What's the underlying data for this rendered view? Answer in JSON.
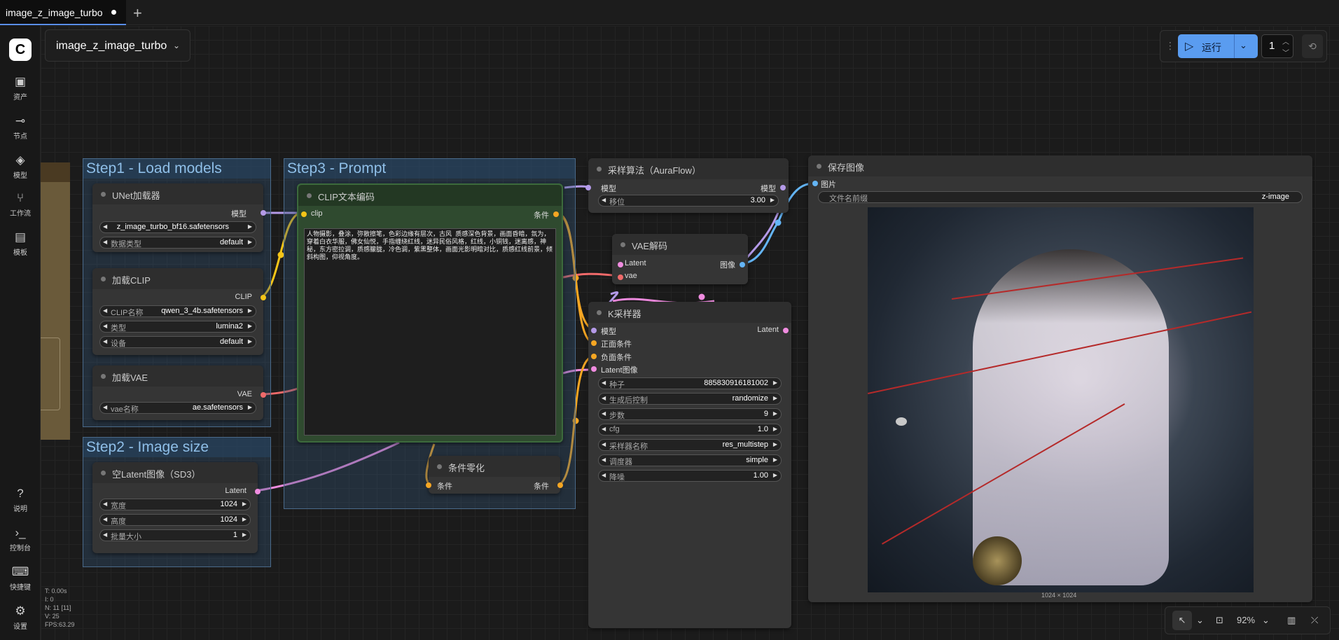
{
  "tabs": [
    {
      "label": "image_z_image_turbo"
    }
  ],
  "sidebar": {
    "items": [
      {
        "label": "资产",
        "icon": "image-icon"
      },
      {
        "label": "节点",
        "icon": "node-icon"
      },
      {
        "label": "模型",
        "icon": "model-icon"
      },
      {
        "label": "工作流",
        "icon": "workflow-icon"
      },
      {
        "label": "模板",
        "icon": "template-icon"
      }
    ],
    "bottom_items": [
      {
        "label": "说明",
        "icon": "help-icon"
      },
      {
        "label": "控制台",
        "icon": "console-icon"
      },
      {
        "label": "快捷键",
        "icon": "keyboard-icon"
      },
      {
        "label": "设置",
        "icon": "settings-icon"
      }
    ]
  },
  "workflow_name": "image_z_image_turbo",
  "run": {
    "label": "运行",
    "count": "1"
  },
  "groups": {
    "step1": "Step1 - Load models",
    "step2": "Step2 - Image size",
    "step3": "Step3 - Prompt"
  },
  "nodes": {
    "unet": {
      "title": "UNet加载器",
      "out": "模型",
      "w_unet_value": "z_image_turbo_bf16.safetensors",
      "w_dtype_label": "数据类型",
      "w_dtype_value": "default"
    },
    "clip": {
      "title": "加载CLIP",
      "out": "CLIP",
      "w_name_label": "CLIP名称",
      "w_name_value": "qwen_3_4b.safetensors",
      "w_type_label": "类型",
      "w_type_value": "lumina2",
      "w_device_label": "设备",
      "w_device_value": "default"
    },
    "vae": {
      "title": "加载VAE",
      "out": "VAE",
      "w_label": "vae名称",
      "w_value": "ae.safetensors"
    },
    "latent": {
      "title": "空Latent图像（SD3）",
      "out": "Latent",
      "w_width_label": "宽度",
      "w_width_value": "1024",
      "w_height_label": "高度",
      "w_height_value": "1024",
      "w_batch_label": "批量大小",
      "w_batch_value": "1"
    },
    "clipenc": {
      "title": "CLIP文本编码",
      "in": "clip",
      "out": "条件",
      "prompt": "人物摄影，叠涂，弥散擦笔，色彩边缘有层次，古风 质感深色背景，画面昏暗，氛为，穿着白衣华服，佛女仙悦，手指缠绕红线，迷异民俗风格，红线，小铜钱，迷离感，神秘，东方密拉调，质感朦胧，冷色调，紫黑整体，画面光影明暗对比，质感红线前景，倾斜构图，仰视角度。"
    },
    "zero": {
      "title": "条件零化",
      "in": "条件",
      "out": "条件"
    },
    "aura": {
      "title": "采样算法（AuraFlow）",
      "in": "模型",
      "out": "模型",
      "w_label": "移位",
      "w_value": "3.00"
    },
    "vaedec": {
      "title": "VAE解码",
      "in1": "Latent",
      "in2": "vae",
      "out": "图像"
    },
    "ksampler": {
      "title": "K采样器",
      "inputs": [
        "模型",
        "正面条件",
        "负面条件",
        "Latent图像"
      ],
      "out": "Latent",
      "widgets": [
        {
          "label": "种子",
          "value": "885830916181002"
        },
        {
          "label": "生成后控制",
          "value": "randomize"
        },
        {
          "label": "步数",
          "value": "9"
        },
        {
          "label": "cfg",
          "value": "1.0"
        },
        {
          "label": "采样器名称",
          "value": "res_multistep"
        },
        {
          "label": "调度器",
          "value": "simple"
        },
        {
          "label": "降噪",
          "value": "1.00"
        }
      ]
    },
    "save": {
      "title": "保存图像",
      "in": "图片",
      "w_label": "文件名前缀",
      "w_value": "z-image",
      "size": "1024 × 1024"
    }
  },
  "zoom": "92%",
  "stats": [
    "T: 0.00s",
    "I: 0",
    "N: 11 [11]",
    "V: 25",
    "FPS:63.29"
  ],
  "colors": {
    "accent": "#5a9cf0",
    "clip_link": "#f5c518",
    "model_link": "#b49ae8",
    "vae_link": "#f06a6a",
    "latent_link": "#f08ce0",
    "cond_link": "#f5a623",
    "image_link": "#64b5f6"
  }
}
